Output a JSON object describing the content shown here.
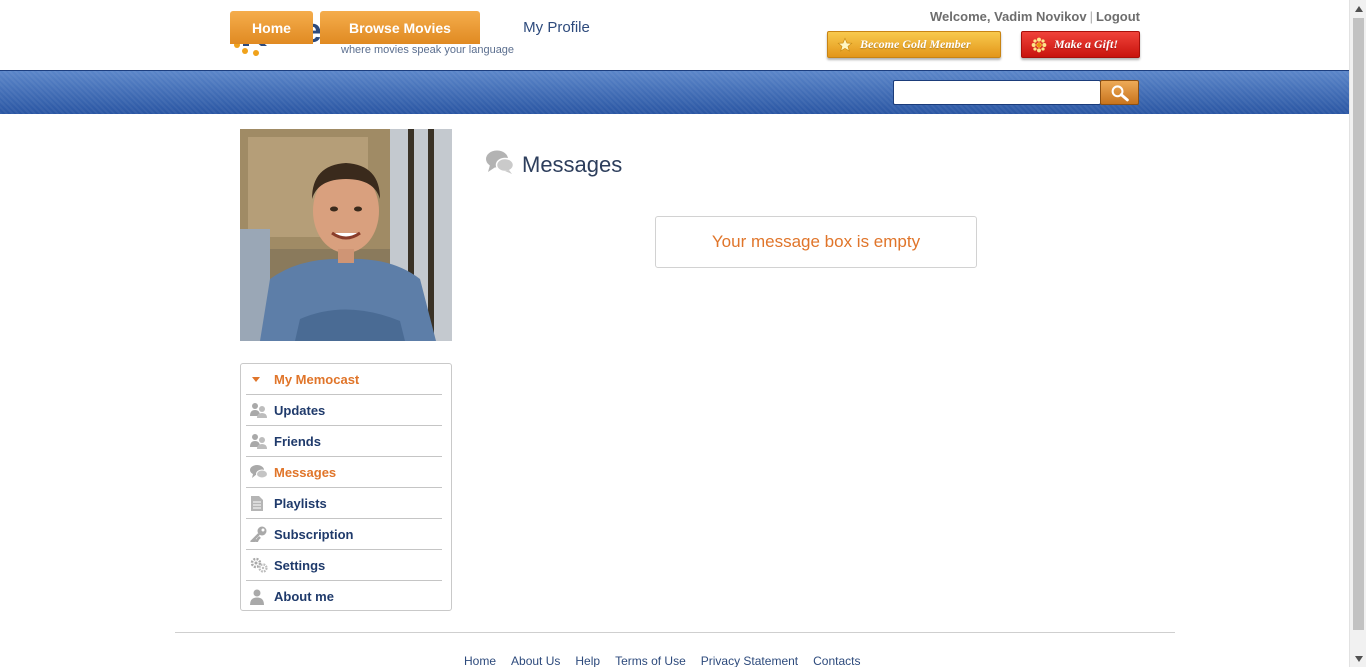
{
  "header": {
    "logo_word": "memocast",
    "logo_tagline": "where movies speak your language",
    "welcome_text": "Welcome, Vadim Novikov",
    "separator": "|",
    "logout_label": "Logout",
    "gold_button_label": "Become Gold Member",
    "gift_button_label": "Make a Gift!",
    "languages": [
      "russian-flag-icon",
      "uk-flag-icon"
    ]
  },
  "nav": {
    "tabs": [
      {
        "label": "Home"
      },
      {
        "label": "Browse Movies"
      },
      {
        "label": "My Profile",
        "active": true
      }
    ],
    "search_value": "",
    "search_icon": "magnifier-icon"
  },
  "sidebar": {
    "items": [
      {
        "label": "My Memocast",
        "icon": "triangle-down-icon",
        "active_header": true
      },
      {
        "label": "Updates",
        "icon": "users-icon"
      },
      {
        "label": "Friends",
        "icon": "users-icon"
      },
      {
        "label": "Messages",
        "icon": "speech-bubbles-icon",
        "active": true
      },
      {
        "label": "Playlists",
        "icon": "document-icon"
      },
      {
        "label": "Subscription",
        "icon": "key-icon"
      },
      {
        "label": "Settings",
        "icon": "gears-icon"
      },
      {
        "label": "About me",
        "icon": "person-icon"
      }
    ]
  },
  "main": {
    "title": "Messages",
    "empty_message": "Your message box is empty"
  },
  "footer": {
    "links": [
      "Home",
      "About Us",
      "Help",
      "Terms of Use",
      "Privacy Statement",
      "Contacts"
    ]
  },
  "colors": {
    "accent_orange": "#e0752a",
    "nav_blue": "#2a56a3",
    "text_navy": "#1f3a6b"
  }
}
